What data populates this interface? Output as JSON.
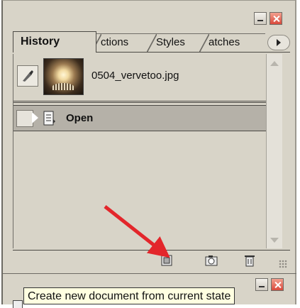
{
  "panel": {
    "tabs": [
      "History",
      "ctions",
      "Styles",
      "atches"
    ],
    "snapshot_name": "0504_vervetoo.jpg",
    "states": [
      {
        "label": "Open"
      }
    ],
    "bottom_icons": [
      "new-document-icon",
      "camera-icon",
      "trash-icon"
    ]
  },
  "tooltip": "Create new document from current state",
  "colors": {
    "arrow": "#e3262b",
    "panel": "#d8d4c8",
    "selected_state": "#b5b1a8",
    "tooltip_bg": "#ffffe1"
  }
}
